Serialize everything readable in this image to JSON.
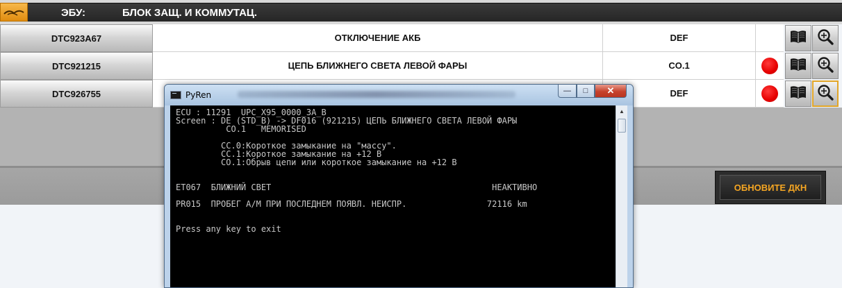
{
  "header": {
    "logo_icon": "bird-logo-icon",
    "ecu_label": "ЭБУ:",
    "title": "БЛОК ЗАЩ. И КОММУТАЦ."
  },
  "rows": [
    {
      "code": "DTC923A67",
      "description": "ОТКЛЮЧЕНИЕ АКБ",
      "status": "DEF",
      "indicator": false,
      "zoom_selected": false
    },
    {
      "code": "DTC921215",
      "description": "ЦЕПЬ БЛИЖНЕГО СВЕТА ЛЕВОЙ ФАРЫ",
      "status": "CO.1",
      "indicator": true,
      "zoom_selected": false
    },
    {
      "code": "DTC926755",
      "description": "",
      "status": "DEF",
      "indicator": true,
      "zoom_selected": true
    }
  ],
  "icons": {
    "book": "book-icon",
    "zoom": "magnifier-icon",
    "indicator_color": "#e60000"
  },
  "refresh_button": {
    "label": "ОБНОВИТЕ ДКН",
    "color": "#f5a623"
  },
  "console_window": {
    "title": "PyRen",
    "title_suffix_blurred": true,
    "controls": {
      "minimize": "—",
      "maximize": "□",
      "close": "✕"
    },
    "lines": [
      "ECU : 11291  UPC_X95_0000_3A_B",
      "Screen : DE (STD_B) -> DF016 (921215) ЦЕПЬ БЛИЖНЕГО СВЕТА ЛЕВОЙ ФАРЫ",
      "          CO.1   MEMORISED",
      "",
      "         CC.0:Короткое замыкание на \"массу\".",
      "         CC.1:Короткое замыкание на +12 В",
      "         CO.1:Обрыв цепи или короткое замыкание на +12 В",
      "",
      "",
      "ET067  БЛИЖНИЙ СВЕТ                                            НЕАКТИВНО",
      "",
      "PR015  ПРОБЕГ А/М ПРИ ПОСЛЕДНЕМ ПОЯВЛ. НЕИСПР.                72116 km",
      "",
      "",
      "Press any key to exit"
    ]
  }
}
